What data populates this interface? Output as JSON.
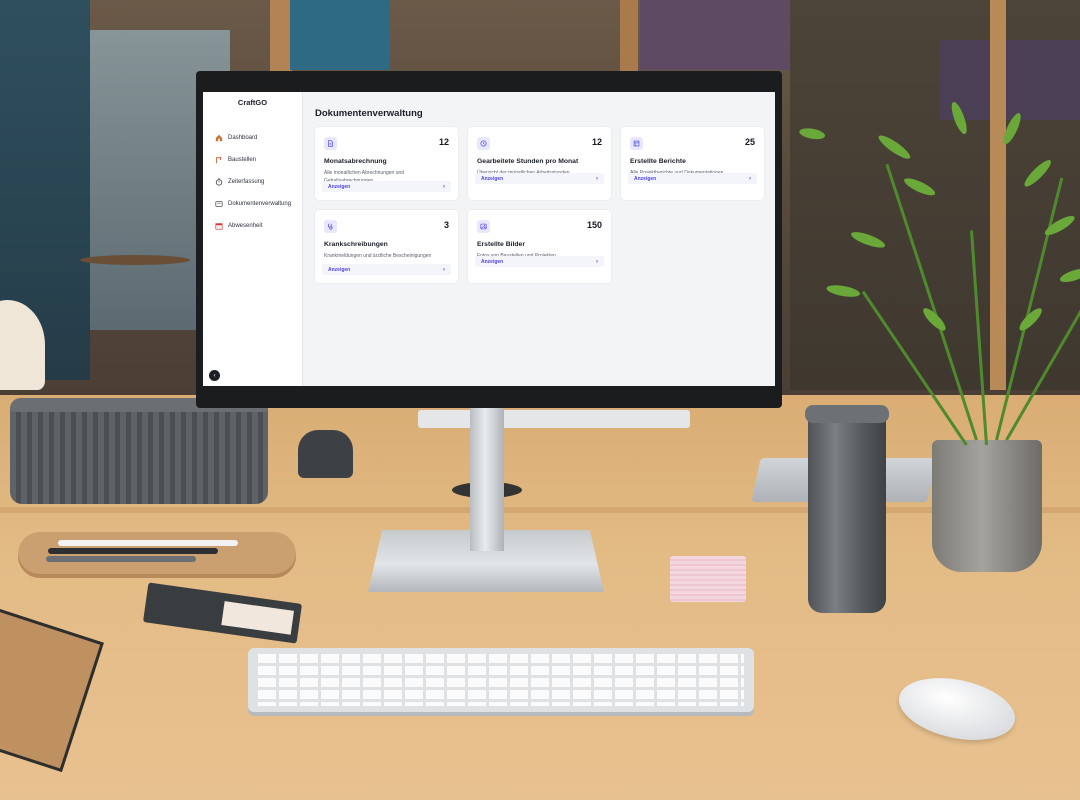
{
  "app": {
    "brand": "CraftGO"
  },
  "sidebar": {
    "items": [
      {
        "label": "Dashboard",
        "icon": "home-icon"
      },
      {
        "label": "Baustellen",
        "icon": "construction-icon"
      },
      {
        "label": "Zeiterfassung",
        "icon": "stopwatch-icon"
      },
      {
        "label": "Dokumentenverwaltung",
        "icon": "folder-icon"
      },
      {
        "label": "Abwesenheit",
        "icon": "calendar-icon"
      }
    ]
  },
  "main": {
    "title": "Dokumentenverwaltung",
    "cards": [
      {
        "count": "12",
        "title": "Monatsabrechnung",
        "desc": "Alle monatlichen Abrechnungen und Gehaltsabrechnungen",
        "action": "Anzeigen",
        "icon": "document-icon"
      },
      {
        "count": "12",
        "title": "Gearbeitete Stunden pro Monat",
        "desc": "Übersicht der monatlichen Arbeitsstunden",
        "action": "Anzeigen",
        "icon": "clock-icon"
      },
      {
        "count": "25",
        "title": "Erstellte Berichte",
        "desc": "Alle Projektberichte und Dokumentationen",
        "action": "Anzeigen",
        "icon": "report-icon"
      },
      {
        "count": "3",
        "title": "Krankschreibungen",
        "desc": "Krankmeldungen und ärztliche Bescheinigungen",
        "action": "Anzeigen",
        "icon": "stethoscope-icon"
      },
      {
        "count": "150",
        "title": "Erstellte Bilder",
        "desc": "Fotos von Baustellen und Projekten",
        "action": "Anzeigen",
        "icon": "image-icon"
      }
    ]
  },
  "colors": {
    "accent": "#4f46e5",
    "accent_bg": "#e7e8fd",
    "screen_bg": "#f3f4f6"
  }
}
